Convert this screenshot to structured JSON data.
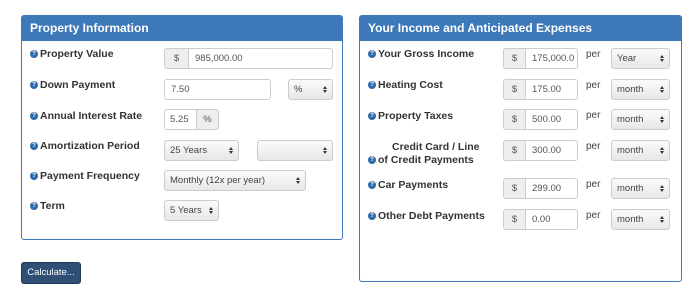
{
  "property": {
    "title": "Property Information",
    "property_value": {
      "label": "Property Value",
      "currency": "$",
      "value": "985,000.00"
    },
    "down_payment": {
      "label": "Down Payment",
      "value": "7.50",
      "unit_option": "%"
    },
    "interest_rate": {
      "label": "Annual Interest Rate",
      "value": "5.25",
      "unit": "%"
    },
    "amortization": {
      "label": "Amortization Period",
      "years_option": "25 Years",
      "months_option": ""
    },
    "frequency": {
      "label": "Payment Frequency",
      "option": "Monthly (12x per year)"
    },
    "term": {
      "label": "Term",
      "option": "5 Years"
    }
  },
  "income": {
    "title": "Your Income and Anticipated Expenses",
    "per_label": "per",
    "rows": [
      {
        "label": "Your Gross Income",
        "currency": "$",
        "value": "175,000.0",
        "period": "Year"
      },
      {
        "label": "Heating Cost",
        "currency": "$",
        "value": "175.00",
        "period": "month"
      },
      {
        "label": "Property Taxes",
        "currency": "$",
        "value": "500.00",
        "period": "month"
      },
      {
        "label_line1": "Credit Card / Line",
        "label_line2": "of Credit Payments",
        "currency": "$",
        "value": "300.00",
        "period": "month"
      },
      {
        "label": "Car Payments",
        "currency": "$",
        "value": "299.00",
        "period": "month"
      },
      {
        "label": "Other Debt Payments",
        "currency": "$",
        "value": "0.00",
        "period": "month"
      }
    ]
  },
  "actions": {
    "calculate_label": "Calculate..."
  },
  "icons": {
    "help": "question-circle-icon",
    "select_arrows": "up-down-caret-icon"
  },
  "colors": {
    "panel_header": "#3d78b8",
    "button": "#2f4f74"
  }
}
